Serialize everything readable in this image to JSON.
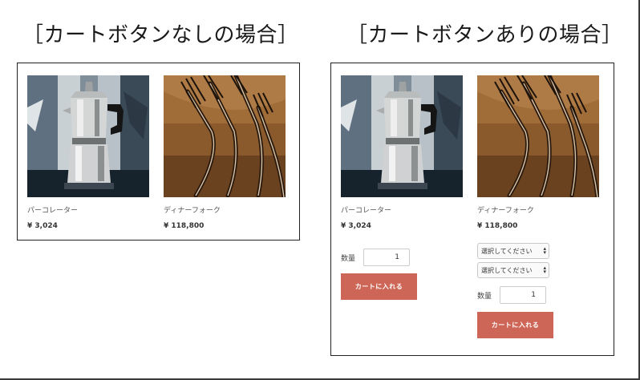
{
  "headings": {
    "left": "［カートボタンなしの場合］",
    "right": "［カートボタンありの場合］"
  },
  "left_panel": {
    "products": [
      {
        "name": "パーコレーター",
        "price": "¥ 3,024",
        "image": "percolator-photo"
      },
      {
        "name": "ディナーフォーク",
        "price": "¥ 118,800",
        "image": "forks-photo"
      }
    ]
  },
  "right_panel": {
    "products": [
      {
        "name": "パーコレーター",
        "price": "¥ 3,024",
        "image": "percolator-photo",
        "qty_label": "数量",
        "qty_value": "1",
        "cart_button": "カートに入れる"
      },
      {
        "name": "ディナーフォーク",
        "price": "¥ 118,800",
        "image": "forks-photo",
        "selects": [
          "選択してください",
          "選択してください"
        ],
        "qty_label": "数量",
        "qty_value": "1",
        "cart_button": "カートに入れる"
      }
    ]
  },
  "colors": {
    "cart_button": "#cd6656",
    "panel_border": "#222222"
  }
}
